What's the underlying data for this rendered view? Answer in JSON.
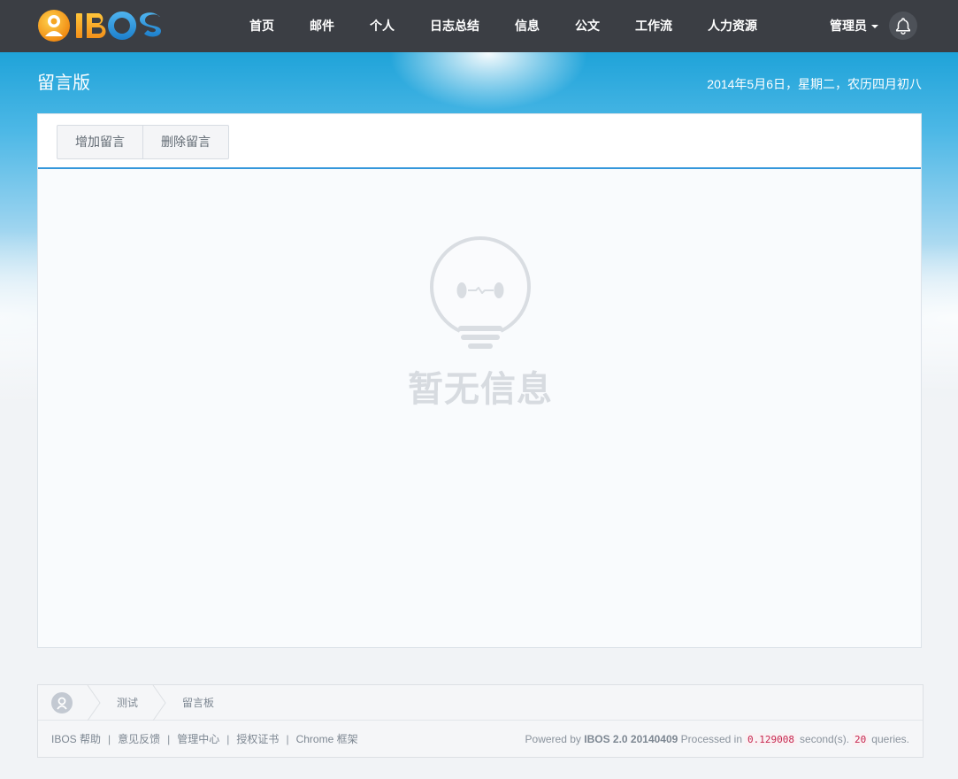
{
  "brand": {
    "logo_text": "IBOS"
  },
  "nav": {
    "items": [
      "首页",
      "邮件",
      "个人",
      "日志总结",
      "信息",
      "公文",
      "工作流",
      "人力资源"
    ],
    "user_label": "管理员"
  },
  "header": {
    "title": "留言版",
    "date": "2014年5月6日，星期二，农历四月初八"
  },
  "toolbar": {
    "add_label": "增加留言",
    "delete_label": "删除留言"
  },
  "empty_state": {
    "text": "暂无信息"
  },
  "breadcrumb": [
    "测试",
    "留言板"
  ],
  "footer": {
    "links": [
      "IBOS 帮助",
      "意见反馈",
      "管理中心",
      "授权证书",
      "Chrome 框架"
    ],
    "powered_prefix": "Powered by",
    "product": "IBOS 2.0 20140409",
    "processed_label": "Processed in",
    "seconds": "0.129008",
    "seconds_label": "second(s).",
    "queries": "20",
    "queries_label": "queries."
  },
  "colors": {
    "topbar": "#3b3e44",
    "accent": "#3497db",
    "logo_orange": "#f5a623",
    "logo_blue": "#2f9de0"
  },
  "icons": [
    "logo-icon",
    "bell-icon",
    "caret-down-icon",
    "lightbulb-icon",
    "home-icon"
  ]
}
